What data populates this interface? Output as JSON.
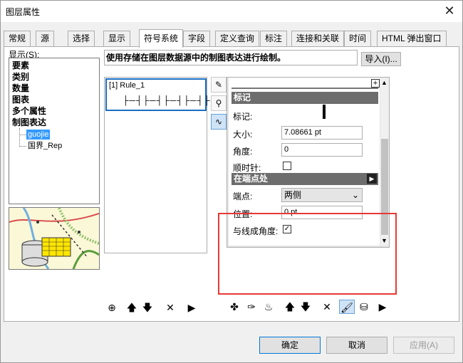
{
  "window": {
    "title": "图层属性",
    "close_glyph": "✕"
  },
  "tabs": [
    {
      "label": "常规"
    },
    {
      "label": "源"
    },
    {
      "label": "选择"
    },
    {
      "label": "显示"
    },
    {
      "label": "符号系统"
    },
    {
      "label": "字段"
    },
    {
      "label": "定义查询"
    },
    {
      "label": "标注"
    },
    {
      "label": "连接和关联"
    },
    {
      "label": "时间"
    },
    {
      "label": "HTML 弹出窗口"
    }
  ],
  "show": {
    "label": "显示(S):",
    "items": [
      "要素",
      "类别",
      "数量",
      "图表",
      "多个属性",
      "制图表达"
    ],
    "sub_items": [
      "guojie",
      "国界_Rep"
    ]
  },
  "description": "使用存储在图层数据源中的制图表达进行绘制。",
  "import_button": "导入(I)...",
  "rule": {
    "label": "[1] Rule_1",
    "symbol": "├─┤├─┤├─┤├─┤├"
  },
  "props": {
    "marker_header": "标记",
    "marker_label": "标记:",
    "size_label": "大小:",
    "size_value": "7.08661 pt",
    "angle_label": "角度:",
    "angle_value": "0",
    "clockwise_label": "顺时针:",
    "endpoint_header": "在端点处",
    "endpoint_label": "端点:",
    "endpoint_value": "两侧",
    "position_label": "位置:",
    "position_value": "0 pt",
    "line_angle_label": "与线成角度:",
    "line_angle_checked": "✓"
  },
  "footer": {
    "ok": "确定",
    "cancel": "取消",
    "apply": "应用(A)"
  },
  "colors": {
    "accent": "#1b6ec2",
    "highlight": "#e53935",
    "header_gray": "#6d6d6d"
  }
}
